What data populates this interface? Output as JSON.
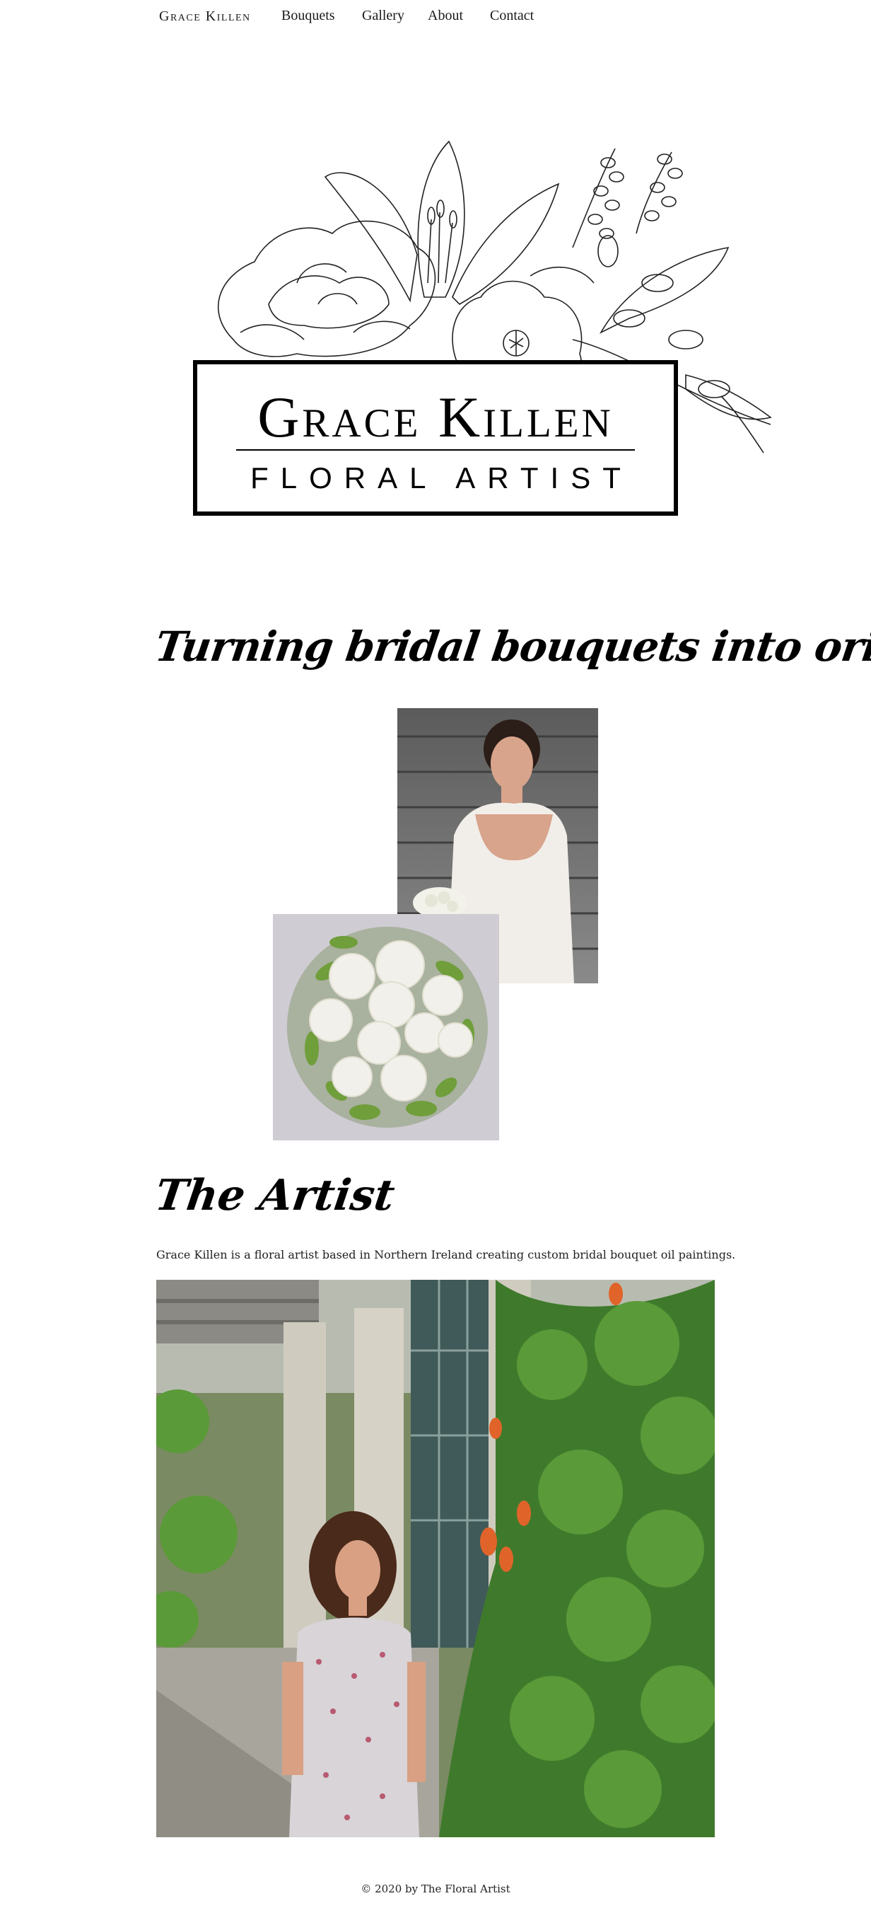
{
  "nav": {
    "brand": "Grace Killen",
    "links": [
      "Bouquets",
      "Gallery",
      "About",
      "Contact"
    ]
  },
  "logo": {
    "name": "Grace Killen",
    "subtitle": "FLORAL ARTIST"
  },
  "hero": {
    "tagline": "Turning bridal bouquets into original pieces of art"
  },
  "artist": {
    "heading": "The Artist",
    "bio": "Grace Killen is a floral artist based in Northern Ireland creating custom bridal bouquet oil paintings."
  },
  "footer": {
    "copyright": "© 2020 by The Floral Artist"
  }
}
